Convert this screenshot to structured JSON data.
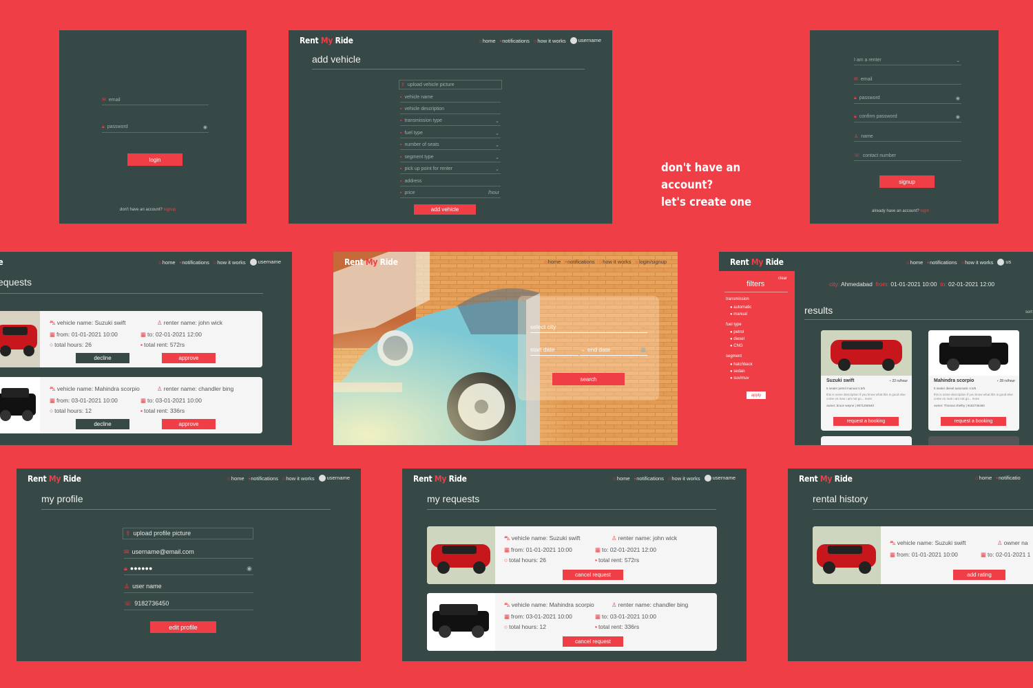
{
  "brand": {
    "rent": "Rent",
    "my": "My",
    "ride": "Ride"
  },
  "nav": {
    "home": "home",
    "notifications": "notifications",
    "how": "how it works",
    "user": "username",
    "login_signup": "login/signup"
  },
  "login": {
    "email": "email",
    "password": "password",
    "button": "login",
    "footer": "don't have an account?",
    "footer_link": "signup"
  },
  "add_vehicle": {
    "title": "add vehicle",
    "fields": [
      "upload vehicle picture",
      "vehicle name",
      "vehicle description",
      "transmission type",
      "fuel type",
      "number of seats",
      "segment type",
      "pick up point for renter",
      "address",
      "price"
    ],
    "price_unit": "/hour",
    "button": "add vehicle"
  },
  "signup": {
    "headline1": "don't have an account?",
    "headline2": "let's create one",
    "role": "I am a renter",
    "fields": [
      "email",
      "password",
      "confirm password",
      "name",
      "contact number"
    ],
    "button": "signup",
    "footer": "already have an account?",
    "footer_link": "login"
  },
  "requests": {
    "title": "requests",
    "items": [
      {
        "vehicle": "vehicle name: Suzuki swift",
        "renter": "renter name: john wick",
        "from": "from: 01-01-2021 10:00",
        "to": "to: 02-01-2021 12:00",
        "hours": "total hours: 26",
        "rent": "total rent: 572rs"
      },
      {
        "vehicle": "vehicle name: Mahindra scorpio",
        "renter": "renter name: chandler bing",
        "from": "from: 03-01-2021 10:00",
        "to": "to: 03-01-2021 10:00",
        "hours": "total hours: 12",
        "rent": "total rent: 336rs"
      }
    ],
    "decline": "decline",
    "approve": "approve"
  },
  "hero": {
    "city": "select city",
    "start": "start date",
    "end": "end date",
    "search": "search"
  },
  "results": {
    "filters": "filters",
    "clear": "clear",
    "transmission": "transmission",
    "t_opts": [
      "automatic",
      "manual"
    ],
    "fuel": "fuel type",
    "f_opts": [
      "petrol",
      "diesel",
      "CNG"
    ],
    "segment": "segment",
    "s_opts": [
      "hatchback",
      "sedan",
      "suv/muv"
    ],
    "apply": "apply",
    "city_label": "city:",
    "city": "Ahmedabad",
    "from_label": "from:",
    "from": "01-01-2021 10:00",
    "to_label": "to:",
    "to": "02-01-2021 12:00",
    "title": "results",
    "sort": "sort",
    "cars": [
      {
        "name": "Suzuki swift",
        "price": "22 rs/hour",
        "specs": "5 seater   petrol   manual   4.5/5",
        "desc": "this is some description if you know what this is good else come on man i am not go... more",
        "owner": "owner: bruce wayne | 9871256940"
      },
      {
        "name": "Mahindra scorpio",
        "price": "28 rs/hour",
        "specs": "5 seater   diesel   automatic   4.5/5",
        "desc": "this is some description if you know what this is good else come on man i am not go... more",
        "owner": "owner: Thomas shelby | 9182736450"
      }
    ],
    "book": "request a booking"
  },
  "profile": {
    "title": "my profile",
    "upload": "upload profile picture",
    "email": "username@email.com",
    "password": "●●●●●●",
    "name": "user name",
    "phone": "9182736450",
    "button": "edit profile"
  },
  "myreq": {
    "title": "my requests",
    "cancel": "cancel request"
  },
  "history": {
    "title": "rental history",
    "vehicle": "vehicle name: Suzuki swift",
    "owner": "owner na",
    "from": "from: 01-01-2021 10:00",
    "to": "to: 02-01-2021 1",
    "button": "add rating"
  }
}
